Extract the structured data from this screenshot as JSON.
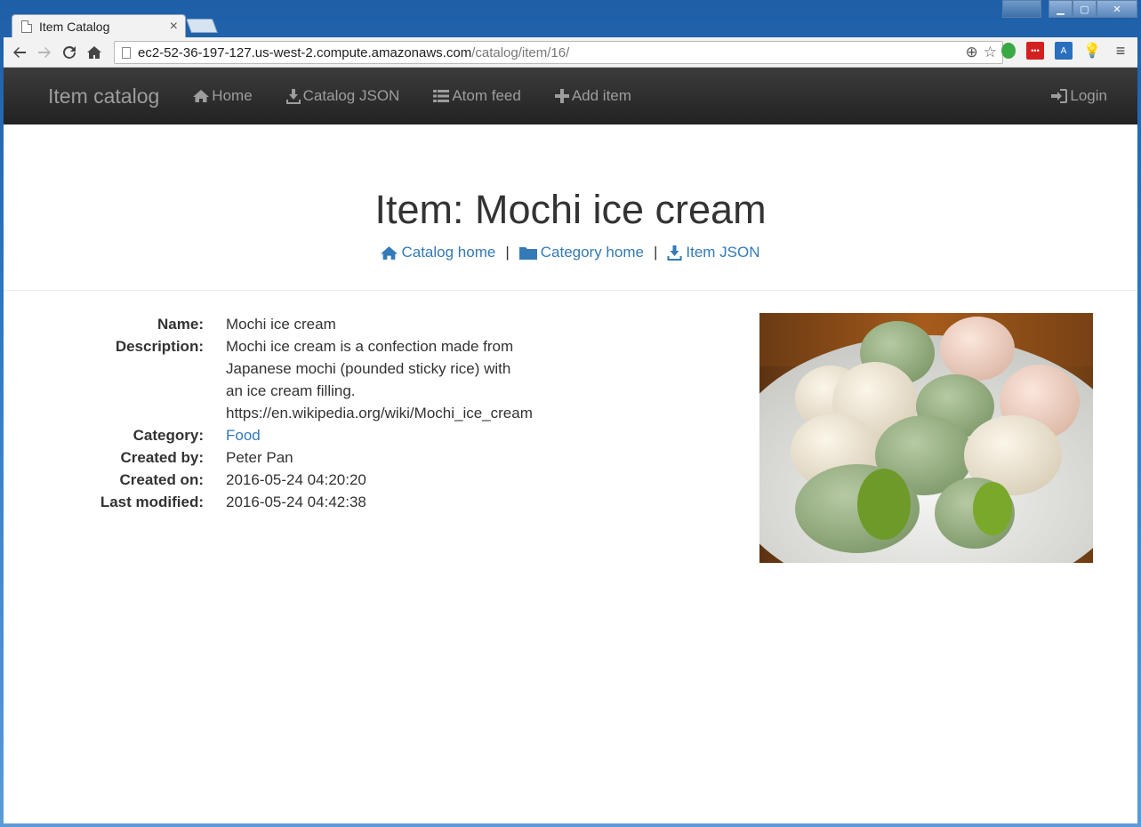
{
  "browser": {
    "tab_title": "Item Catalog",
    "url_host": "ec2-52-36-197-127.us-west-2.compute.amazonaws.com",
    "url_path": "/catalog/item/16/"
  },
  "navbar": {
    "brand": "Item catalog",
    "links": [
      "Home",
      "Catalog JSON",
      "Atom feed",
      "Add item"
    ],
    "login": "Login"
  },
  "header": {
    "title": "Item: Mochi ice cream",
    "links": [
      "Catalog home",
      "Category home",
      "Item JSON"
    ],
    "separator": "|"
  },
  "item": {
    "labels": {
      "name": "Name:",
      "description": "Description:",
      "category": "Category:",
      "created_by": "Created by:",
      "created_on": "Created on:",
      "last_modified": "Last modified:"
    },
    "name": "Mochi ice cream",
    "description_lines": [
      "Mochi ice cream is a confection made from",
      "Japanese mochi (pounded sticky rice) with",
      "an ice cream filling.",
      "https://en.wikipedia.org/wiki/Mochi_ice_cream"
    ],
    "category": "Food",
    "created_by": "Peter Pan",
    "created_on": "2016-05-24 04:20:20",
    "last_modified": "2016-05-24 04:42:38"
  },
  "colors": {
    "navbar_bg": "#222222",
    "navbar_text": "#9d9d9d",
    "link": "#337ab7",
    "text": "#333333"
  }
}
